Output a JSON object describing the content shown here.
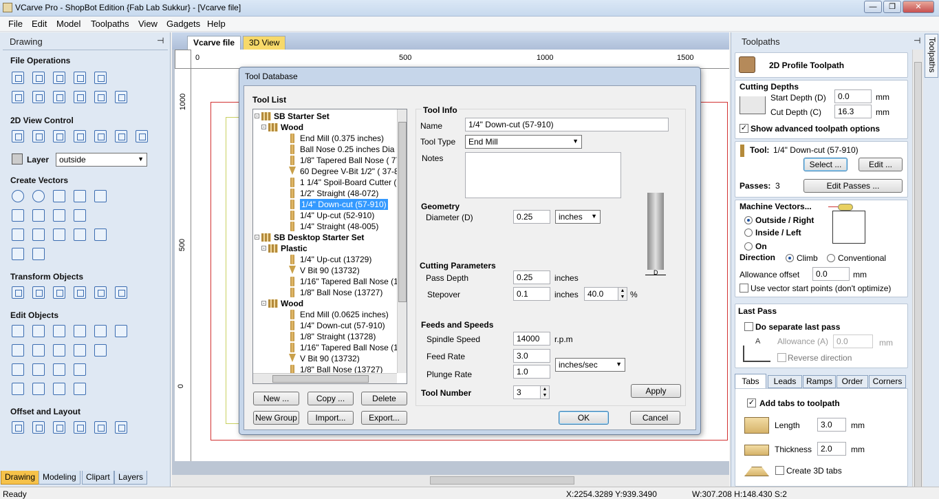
{
  "window": {
    "title": "VCarve Pro - ShopBot Edition {Fab Lab Sukkur} - [Vcarve file]",
    "minimize": "—",
    "restore": "❐",
    "close": "✕"
  },
  "menu": [
    "File",
    "Edit",
    "Model",
    "Toolpaths",
    "View",
    "Gadgets",
    "Help"
  ],
  "left": {
    "title": "Drawing",
    "sections": {
      "file_operations": "File Operations",
      "view_control": "2D View Control",
      "create_vectors": "Create Vectors",
      "transform_objects": "Transform Objects",
      "edit_objects": "Edit Objects",
      "offset_layout": "Offset and Layout"
    },
    "layer_label": "Layer",
    "layer_value": "outside",
    "bottom_tabs": [
      "Drawing",
      "Modeling",
      "Clipart",
      "Layers"
    ]
  },
  "doc": {
    "tabs": [
      "Vcarve file",
      "3D View"
    ],
    "ruler_top": [
      "0",
      "500",
      "1000",
      "1500"
    ],
    "ruler_left": [
      "1000",
      "500",
      "0"
    ]
  },
  "dialog": {
    "title": "Tool Database",
    "tool_list_label": "Tool List",
    "tree": [
      {
        "text": "SB Starter Set",
        "kind": "group"
      },
      {
        "text": "Wood",
        "kind": "folder"
      },
      {
        "text": "End Mill (0.375 inches)",
        "kind": "tool"
      },
      {
        "text": "Ball Nose 0.25 inches Dia",
        "kind": "tool"
      },
      {
        "text": "1/8\" Tapered Ball Nose ( 77-1",
        "kind": "tool"
      },
      {
        "text": "60 Degree V-Bit 1/2\"  ( 37-82",
        "kind": "vbit"
      },
      {
        "text": "1 1/4\" Spoil-Board Cutter  ( 9",
        "kind": "tool"
      },
      {
        "text": "1/2\" Straight  (48-072)",
        "kind": "tool"
      },
      {
        "text": "1/4\"  Down-cut (57-910)",
        "kind": "tool",
        "selected": true
      },
      {
        "text": "1/4\" Up-cut (52-910)",
        "kind": "tool"
      },
      {
        "text": "1/4\" Straight  (48-005)",
        "kind": "tool"
      },
      {
        "text": "SB Desktop Starter Set",
        "kind": "group"
      },
      {
        "text": "Plastic",
        "kind": "folder"
      },
      {
        "text": "1/4\" Up-cut (13729)",
        "kind": "tool"
      },
      {
        "text": "V Bit 90 (13732)",
        "kind": "vbit"
      },
      {
        "text": "1/16\" Tapered Ball Nose (137",
        "kind": "tool"
      },
      {
        "text": "1/8\" Ball Nose (13727)",
        "kind": "tool"
      },
      {
        "text": "Wood",
        "kind": "folder"
      },
      {
        "text": "End Mill (0.0625 inches)",
        "kind": "tool"
      },
      {
        "text": "1/4\"  Down-cut (57-910)",
        "kind": "tool"
      },
      {
        "text": "1/8\" Straight (13728)",
        "kind": "tool"
      },
      {
        "text": "1/16\" Tapered Ball Nose (137",
        "kind": "tool"
      },
      {
        "text": "V Bit 90 (13732)",
        "kind": "vbit"
      },
      {
        "text": "1/8\" Ball Nose (13727)",
        "kind": "tool"
      }
    ],
    "buttons": {
      "new": "New ...",
      "copy": "Copy ...",
      "delete": "Delete",
      "new_group": "New Group",
      "import": "Import...",
      "export": "Export...",
      "apply": "Apply",
      "ok": "OK",
      "cancel": "Cancel"
    },
    "tool_info": {
      "heading": "Tool Info",
      "name_label": "Name",
      "name_value": "1/4\"  Down-cut (57-910)",
      "type_label": "Tool Type",
      "type_value": "End Mill",
      "notes_label": "Notes"
    },
    "geometry": {
      "heading": "Geometry",
      "diameter_label": "Diameter (D)",
      "diameter_value": "0.25",
      "units_value": "inches",
      "d_mark": "D"
    },
    "cutting": {
      "heading": "Cutting Parameters",
      "pass_depth_label": "Pass Depth",
      "pass_depth_value": "0.25",
      "pass_depth_unit": "inches",
      "stepover_label": "Stepover",
      "stepover_value": "0.1",
      "stepover_unit": "inches",
      "stepover_pct": "40.0",
      "pct_sign": "%"
    },
    "feeds": {
      "heading": "Feeds and Speeds",
      "spindle_label": "Spindle Speed",
      "spindle_value": "14000",
      "spindle_unit": "r.p.m",
      "feed_label": "Feed Rate",
      "feed_value": "3.0",
      "rate_units": "inches/sec",
      "plunge_label": "Plunge Rate",
      "plunge_value": "1.0"
    },
    "tool_number": {
      "label": "Tool Number",
      "value": "3"
    }
  },
  "right": {
    "title": "Toolpaths",
    "vertical_tab": "Toolpaths",
    "header": "2D Profile Toolpath",
    "cutting_depths": {
      "heading": "Cutting Depths",
      "start_label": "Start Depth (D)",
      "start_value": "0.0",
      "start_unit": "mm",
      "cut_label": "Cut Depth (C)",
      "cut_value": "16.3",
      "cut_unit": "mm",
      "advanced": "Show advanced toolpath options"
    },
    "tool": {
      "label": "Tool:",
      "value": "1/4\"  Down-cut (57-910)",
      "select": "Select ...",
      "edit": "Edit ...",
      "passes_label": "Passes:",
      "passes_value": "3",
      "edit_passes": "Edit Passes ..."
    },
    "machine_vectors": {
      "heading": "Machine Vectors...",
      "outside": "Outside / Right",
      "inside": "Inside / Left",
      "on": "On",
      "direction_label": "Direction",
      "climb": "Climb",
      "conventional": "Conventional",
      "allowance_label": "Allowance offset",
      "allowance_value": "0.0",
      "allowance_unit": "mm",
      "vector_start": "Use vector start points (don't optimize)"
    },
    "last_pass": {
      "heading": "Last Pass",
      "separate": "Do separate last pass",
      "allowance_label": "Allowance (A)",
      "allowance_value": "0.0",
      "allowance_unit": "mm",
      "reverse": "Reverse direction",
      "a_mark": "A"
    },
    "tabs_bar": [
      "Tabs",
      "Leads",
      "Ramps",
      "Order",
      "Corners"
    ],
    "tabs": {
      "add": "Add tabs to toolpath",
      "length_label": "Length",
      "length_value": "3.0",
      "length_unit": "mm",
      "thickness_label": "Thickness",
      "thickness_value": "2.0",
      "thickness_unit": "mm",
      "create3d": "Create 3D tabs"
    }
  },
  "status": {
    "ready": "Ready",
    "coords": "X:2254.3289 Y:939.3490",
    "size": "W:307.208  H:148.430  S:2"
  }
}
